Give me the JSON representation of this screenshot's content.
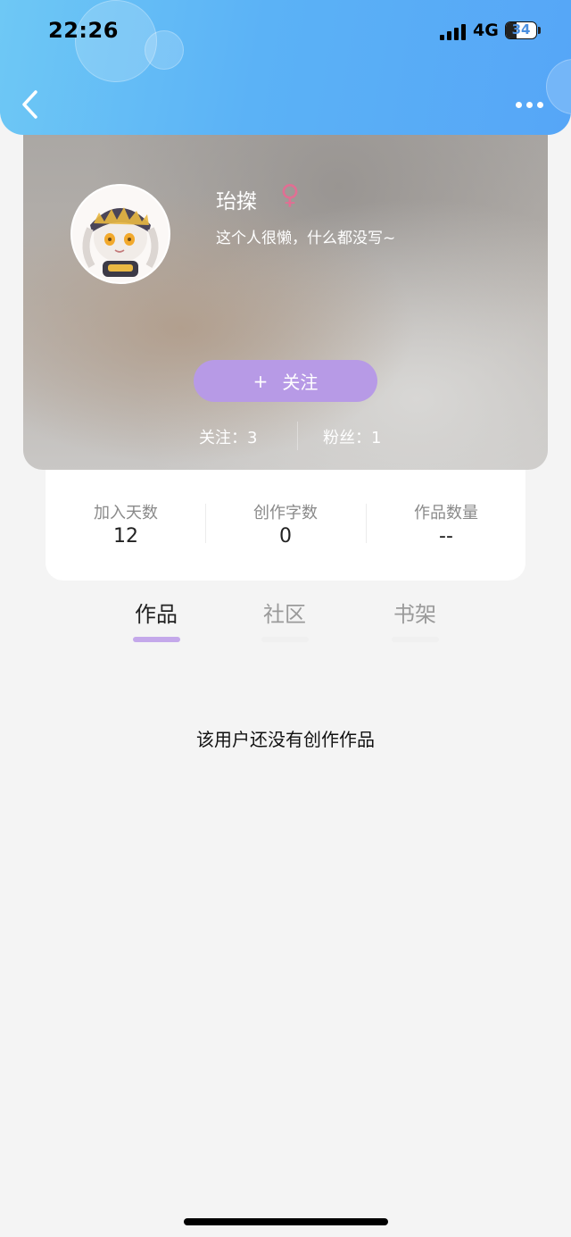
{
  "status_bar": {
    "time": "22:26",
    "network": "4G",
    "battery": "34"
  },
  "nav": {
    "back_icon": "chevron-left-icon",
    "more_icon": "more-horizontal-icon"
  },
  "profile": {
    "username": "珆搩",
    "gender_symbol": "♀",
    "bio": "这个人很懒，什么都没写~",
    "follow_button": {
      "icon": "+",
      "label": "关注"
    },
    "following": "关注：3",
    "fans": "粉丝：1"
  },
  "stats": [
    {
      "label": "加入天数",
      "value": "12"
    },
    {
      "label": "创作字数",
      "value": "0"
    },
    {
      "label": "作品数量",
      "value": "--"
    }
  ],
  "tabs": [
    {
      "label": "作品",
      "active": true
    },
    {
      "label": "社区",
      "active": false
    },
    {
      "label": "书架",
      "active": false
    }
  ],
  "empty_message": "该用户还没有创作作品",
  "colors": {
    "accent": "#b79ae6",
    "header_start": "#6ec8f5",
    "header_end": "#56a6f7",
    "gender": "#e06f93"
  }
}
